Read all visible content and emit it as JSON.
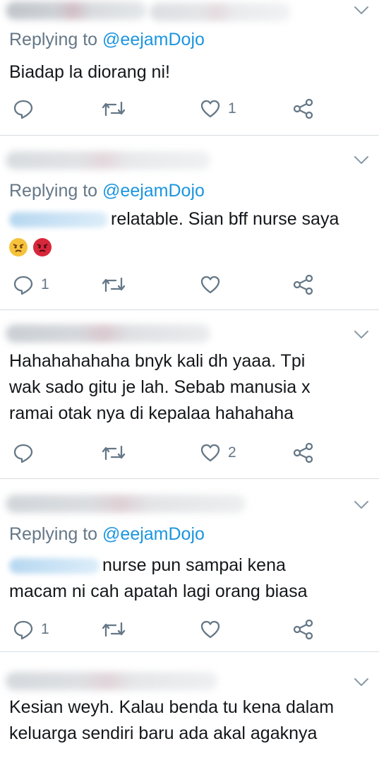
{
  "replies": [
    {
      "replying_to_prefix": "Replying to ",
      "replying_to_handle": "@eejamDojo",
      "lines": [
        "Biadap la diorang ni!"
      ],
      "reply_count": "",
      "like_count": "1"
    },
    {
      "replying_to_prefix": "Replying to ",
      "replying_to_handle": "@eejamDojo",
      "lines": [
        "relatable. Sian bff nurse saya"
      ],
      "emojis": [
        "angry-face",
        "pouting-face"
      ],
      "reply_count": "1",
      "like_count": ""
    },
    {
      "lines": [
        "Hahahahahaha bnyk kali dh yaaa.  Tpi",
        "wak sado gitu je lah.  Sebab manusia x",
        "ramai otak nya di kepalaa hahahaha"
      ],
      "reply_count": "",
      "like_count": "2"
    },
    {
      "replying_to_prefix": "Replying to ",
      "replying_to_handle": "@eejamDojo",
      "lines": [
        "nurse pun sampai kena",
        "macam ni cah apatah lagi orang biasa"
      ],
      "reply_count": "1",
      "like_count": ""
    },
    {
      "lines": [
        "Kesian weyh. Kalau benda tu kena dalam",
        "keluarga sendiri baru ada akal agaknya"
      ]
    }
  ],
  "colors": {
    "text": "#14171a",
    "secondary": "#657786",
    "link": "#1b95e0",
    "divider": "#d8dde2"
  }
}
